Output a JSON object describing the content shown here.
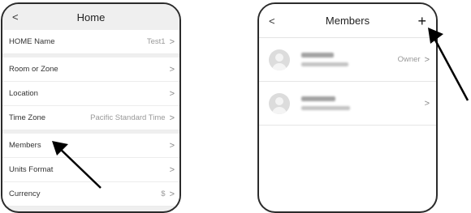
{
  "home_screen": {
    "back_glyph": "<",
    "title": "Home",
    "rows": [
      {
        "label": "HOME Name",
        "value": "Test1"
      },
      {
        "label": "Room or Zone",
        "value": ""
      },
      {
        "label": "Location",
        "value": ""
      },
      {
        "label": "Time Zone",
        "value": "Pacific Standard Time"
      },
      {
        "label": "Members",
        "value": ""
      },
      {
        "label": "Units Format",
        "value": ""
      },
      {
        "label": "Currency",
        "value": "$"
      }
    ]
  },
  "members_screen": {
    "back_glyph": "<",
    "title": "Members",
    "add_glyph": "+",
    "members": [
      {
        "role": "Owner"
      },
      {
        "role": ""
      }
    ]
  },
  "icons": {
    "chevron": "chevron-right-icon",
    "back": "back-arrow-icon",
    "add": "plus-icon",
    "avatar": "default-avatar-icon",
    "pointer": "annotation-arrow"
  },
  "colors": {
    "screen_bg": "#efefef",
    "row_bg": "#ffffff",
    "annotation": "#000000"
  }
}
